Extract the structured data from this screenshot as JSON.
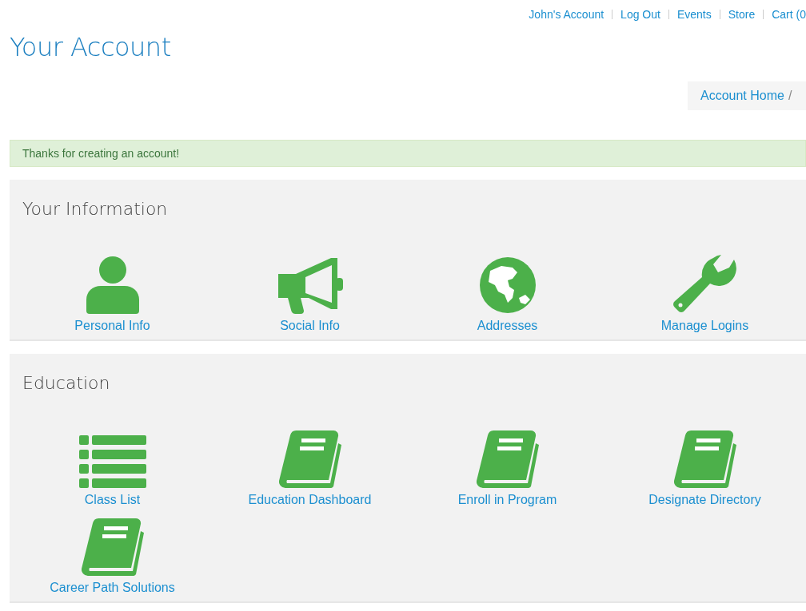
{
  "top_links": [
    "John's Account",
    "Log Out",
    "Events",
    "Store",
    "Cart (0"
  ],
  "title": "Your Account",
  "breadcrumb": {
    "items": [
      "Account Home"
    ],
    "separator": "/"
  },
  "alert": "Thanks for creating an account!",
  "sections": [
    {
      "heading": "Your Information",
      "tiles": [
        {
          "label": "Personal Info",
          "kind": "person"
        },
        {
          "label": "Social Info",
          "kind": "megaphone"
        },
        {
          "label": "Addresses",
          "kind": "globe"
        },
        {
          "label": "Manage Logins",
          "kind": "wrench"
        }
      ]
    },
    {
      "heading": "Education",
      "tiles": [
        {
          "label": "Class List",
          "kind": "list"
        },
        {
          "label": "Education Dashboard",
          "kind": "book"
        },
        {
          "label": "Enroll in Program",
          "kind": "book"
        },
        {
          "label": "Designate Directory",
          "kind": "book"
        },
        {
          "label": "Career Path Solutions",
          "kind": "book"
        }
      ]
    }
  ]
}
